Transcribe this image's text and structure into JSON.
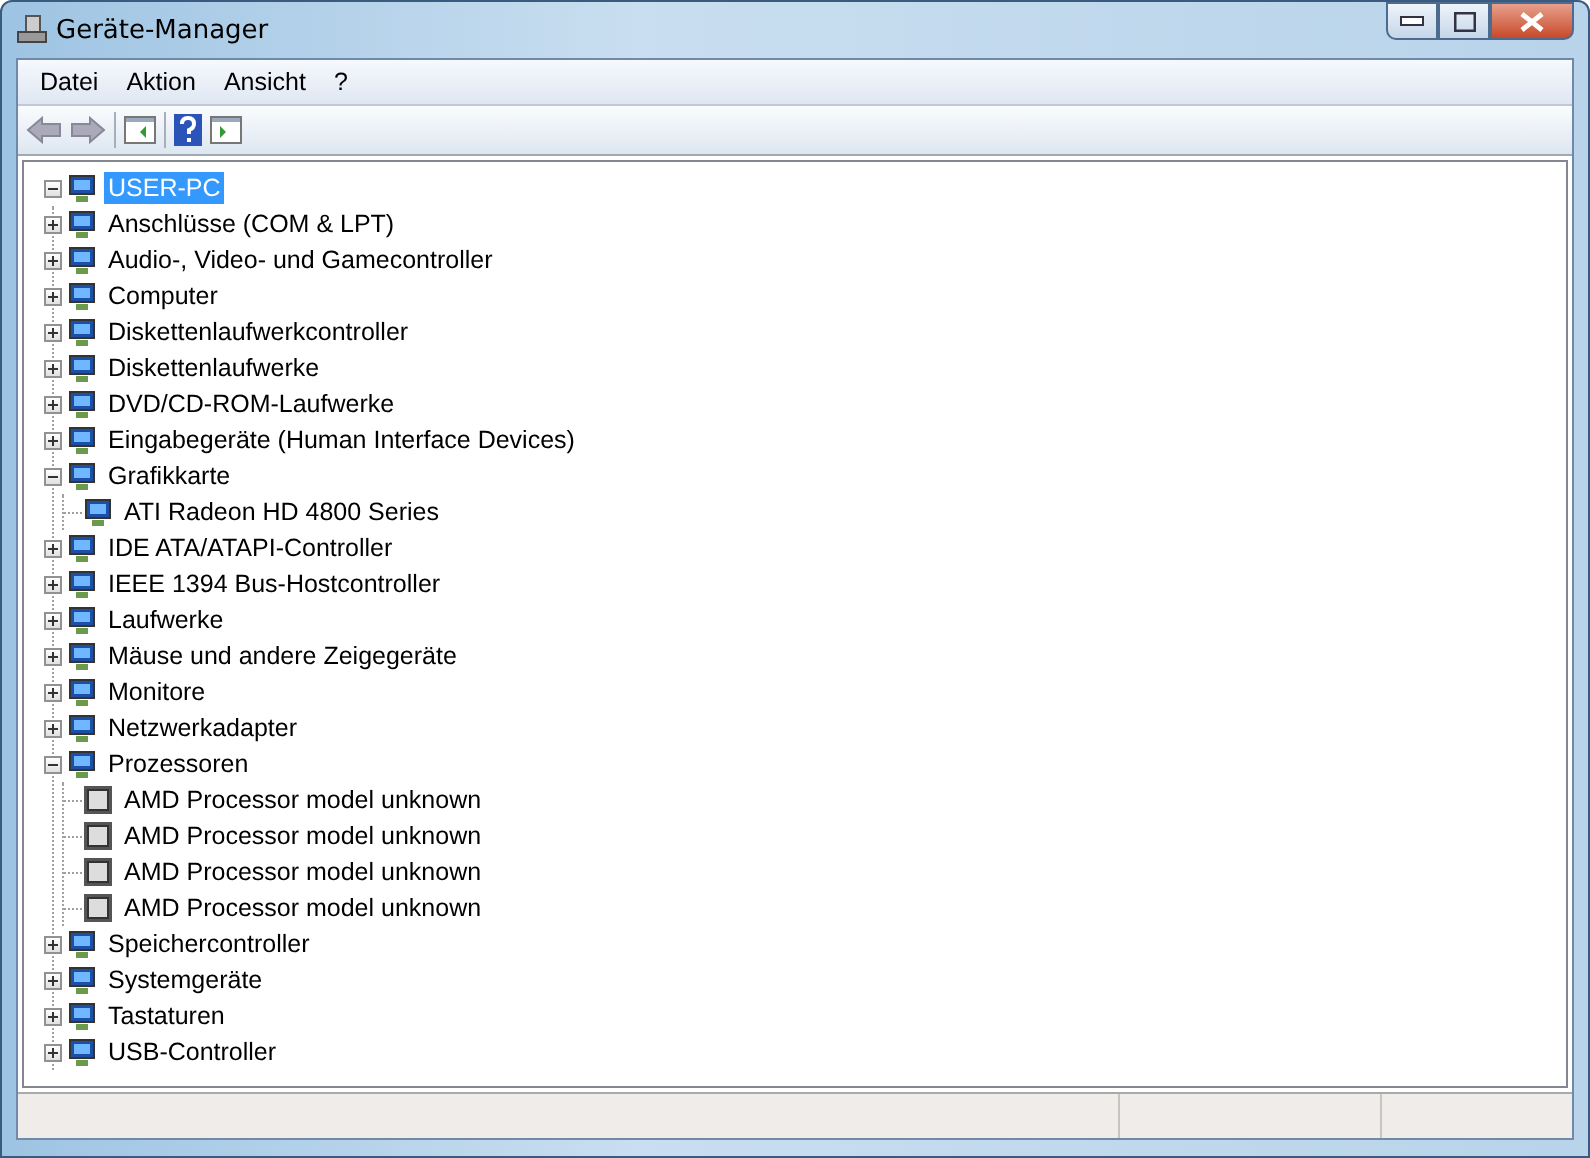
{
  "window": {
    "title": "Geräte-Manager"
  },
  "menu": [
    {
      "label": "Datei"
    },
    {
      "label": "Aktion"
    },
    {
      "label": "Ansicht"
    },
    {
      "label": "?"
    }
  ],
  "tree": {
    "label": "USER-PC",
    "selected": true,
    "expanded": true,
    "children": [
      {
        "label": "Anschlüsse (COM & LPT)",
        "expanded": false
      },
      {
        "label": "Audio-, Video- und Gamecontroller",
        "expanded": false
      },
      {
        "label": "Computer",
        "expanded": false
      },
      {
        "label": "Diskettenlaufwerkcontroller",
        "expanded": false
      },
      {
        "label": "Diskettenlaufwerke",
        "expanded": false
      },
      {
        "label": "DVD/CD-ROM-Laufwerke",
        "expanded": false
      },
      {
        "label": "Eingabegeräte (Human Interface Devices)",
        "expanded": false
      },
      {
        "label": "Grafikkarte",
        "expanded": true,
        "children": [
          {
            "label": "ATI Radeon HD 4800 Series"
          }
        ]
      },
      {
        "label": "IDE ATA/ATAPI-Controller",
        "expanded": false
      },
      {
        "label": "IEEE 1394 Bus-Hostcontroller",
        "expanded": false
      },
      {
        "label": "Laufwerke",
        "expanded": false
      },
      {
        "label": "Mäuse und andere Zeigegeräte",
        "expanded": false
      },
      {
        "label": "Monitore",
        "expanded": false
      },
      {
        "label": "Netzwerkadapter",
        "expanded": false
      },
      {
        "label": "Prozessoren",
        "expanded": true,
        "children": [
          {
            "label": "AMD Processor model unknown"
          },
          {
            "label": "AMD Processor model unknown"
          },
          {
            "label": "AMD Processor model unknown"
          },
          {
            "label": "AMD Processor model unknown"
          }
        ]
      },
      {
        "label": "Speichercontroller",
        "expanded": false
      },
      {
        "label": "Systemgeräte",
        "expanded": false
      },
      {
        "label": "Tastaturen",
        "expanded": false
      },
      {
        "label": "USB-Controller",
        "expanded": false
      }
    ]
  }
}
